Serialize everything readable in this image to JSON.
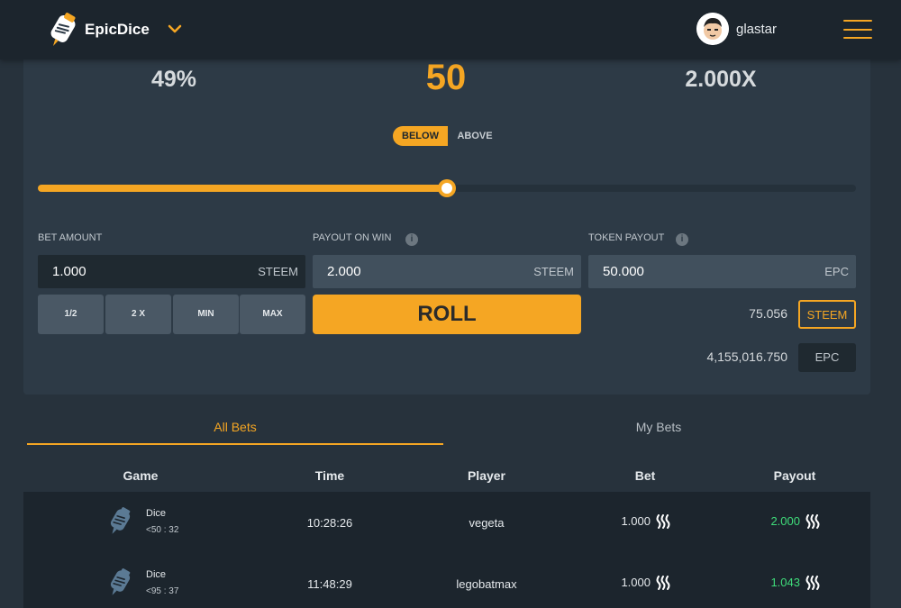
{
  "header": {
    "brand": "EpicDice",
    "username": "glastar",
    "icons": [
      "dice-logo-icon",
      "chevron-down-icon",
      "avatar",
      "hamburger-menu-icon"
    ]
  },
  "game": {
    "win_chance": "49%",
    "target": "50",
    "multiplier": "2.000X",
    "toggle_below": "BELOW",
    "toggle_above": "ABOVE",
    "selected_direction": "below",
    "slider_value": 50,
    "bet_amount_label": "BET AMOUNT",
    "bet_amount_value": "1.000",
    "bet_amount_unit": "STEEM",
    "payout_label": "PAYOUT ON WIN",
    "payout_value": "2.000",
    "payout_unit": "STEEM",
    "token_payout_label": "TOKEN PAYOUT",
    "token_payout_value": "50.000",
    "token_payout_unit": "EPC",
    "quick_buttons": [
      "1/2",
      "2 X",
      "MIN",
      "MAX"
    ],
    "roll_label": "ROLL",
    "balance_steem": "75.056",
    "balance_steem_unit": "STEEM",
    "balance_epc": "4,155,016.750",
    "balance_epc_unit": "EPC",
    "accent_color": "#f5a623"
  },
  "tabs": {
    "all_bets": "All Bets",
    "my_bets": "My Bets",
    "active": "all_bets"
  },
  "table": {
    "headers": [
      "Game",
      "Time",
      "Player",
      "Bet",
      "Payout"
    ],
    "rows": [
      {
        "game": "Dice",
        "detail": "<50 : 32",
        "time": "10:28:26",
        "player": "vegeta",
        "bet": "1.000",
        "payout": "2.000"
      },
      {
        "game": "Dice",
        "detail": "<95 : 37",
        "time": "11:48:29",
        "player": "legobatmax",
        "bet": "1.000",
        "payout": "1.043"
      }
    ],
    "win_color": "#3fdc7a"
  }
}
